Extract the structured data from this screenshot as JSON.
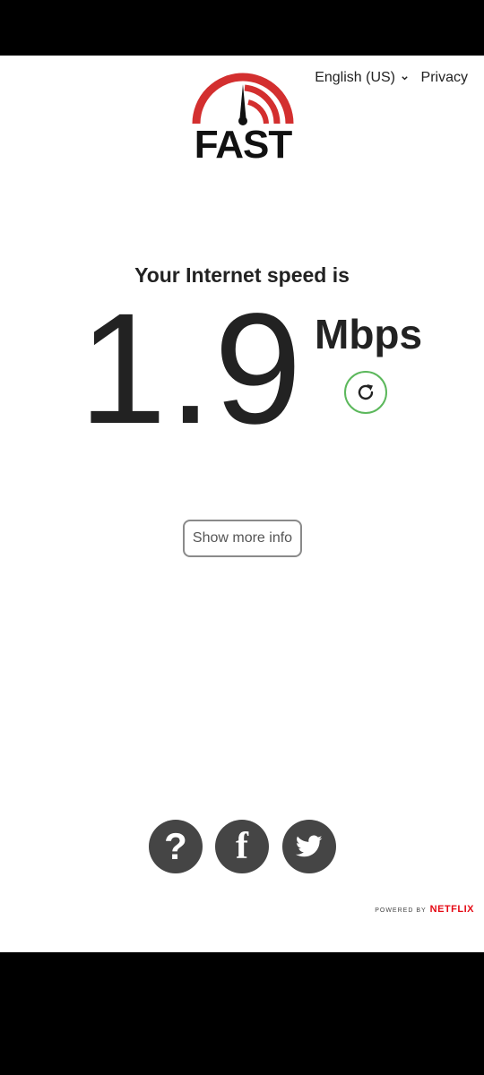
{
  "header": {
    "language": "English (US)",
    "privacy": "Privacy"
  },
  "logo": {
    "text": "FAST",
    "colors": {
      "arc": "#d32f2f",
      "needle": "#111111"
    }
  },
  "result": {
    "headline": "Your Internet speed is",
    "value": "1.9",
    "units": "Mbps",
    "refresh_icon": "refresh-icon"
  },
  "actions": {
    "show_more": "Show more info"
  },
  "social": {
    "help": "?",
    "facebook": "f",
    "twitter_icon": "twitter-bird-icon"
  },
  "footer": {
    "powered_by": "POWERED BY",
    "brand": "NETFLIX"
  },
  "colors": {
    "accent_green": "#5cb85c",
    "button_border": "#8a8a8a",
    "social_bg": "#454545",
    "netflix_red": "#e50914"
  }
}
